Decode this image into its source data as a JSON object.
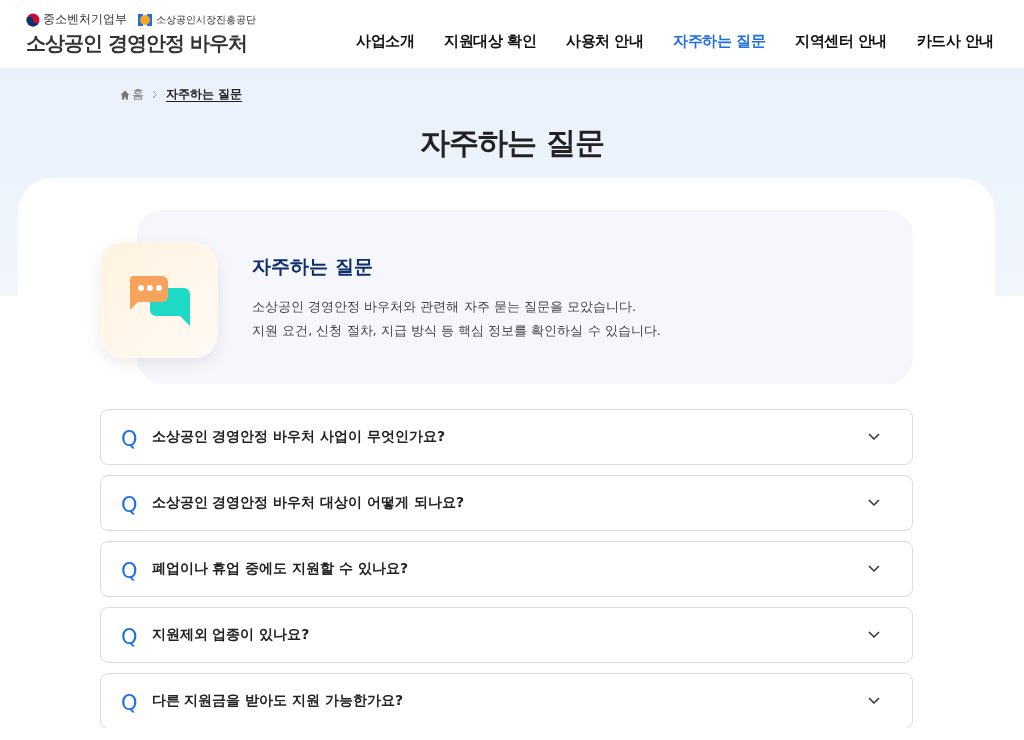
{
  "header": {
    "ministry": "중소벤처기업부",
    "agency": "소상공인시장진흥공단",
    "site_title": "소상공인 경영안정 바우처"
  },
  "nav": [
    {
      "label": "사업소개",
      "selected": false
    },
    {
      "label": "지원대상 확인",
      "selected": false
    },
    {
      "label": "사용처 안내",
      "selected": false
    },
    {
      "label": "자주하는 질문",
      "selected": true
    },
    {
      "label": "지역센터 안내",
      "selected": false
    },
    {
      "label": "카드사 안내",
      "selected": false
    }
  ],
  "breadcrumb": {
    "home": "홈",
    "current": "자주하는 질문"
  },
  "page_title": "자주하는 질문",
  "intro": {
    "title": "자주하는 질문",
    "lines": [
      "소상공인 경영안정 바우처와 관련해 자주 묻는 질문을 모았습니다.",
      "지원 요건, 신청 절차, 지급 방식 등 핵심 정보를 확인하실 수 있습니다."
    ]
  },
  "faq": [
    {
      "marker": "Q",
      "question": "소상공인 경영안정 바우처 사업이 무엇인가요?",
      "expanded": false
    },
    {
      "marker": "Q",
      "question": "소상공인 경영안정 바우처 대상이 어떻게 되나요?",
      "expanded": false
    },
    {
      "marker": "Q",
      "question": "폐업이나 휴업 중에도 지원할 수 있나요?",
      "expanded": false
    },
    {
      "marker": "Q",
      "question": "지원제외 업종이 있나요?",
      "expanded": false
    },
    {
      "marker": "Q",
      "question": "다른 지원금을 받아도 지원 가능한가요?",
      "expanded": false
    }
  ]
}
